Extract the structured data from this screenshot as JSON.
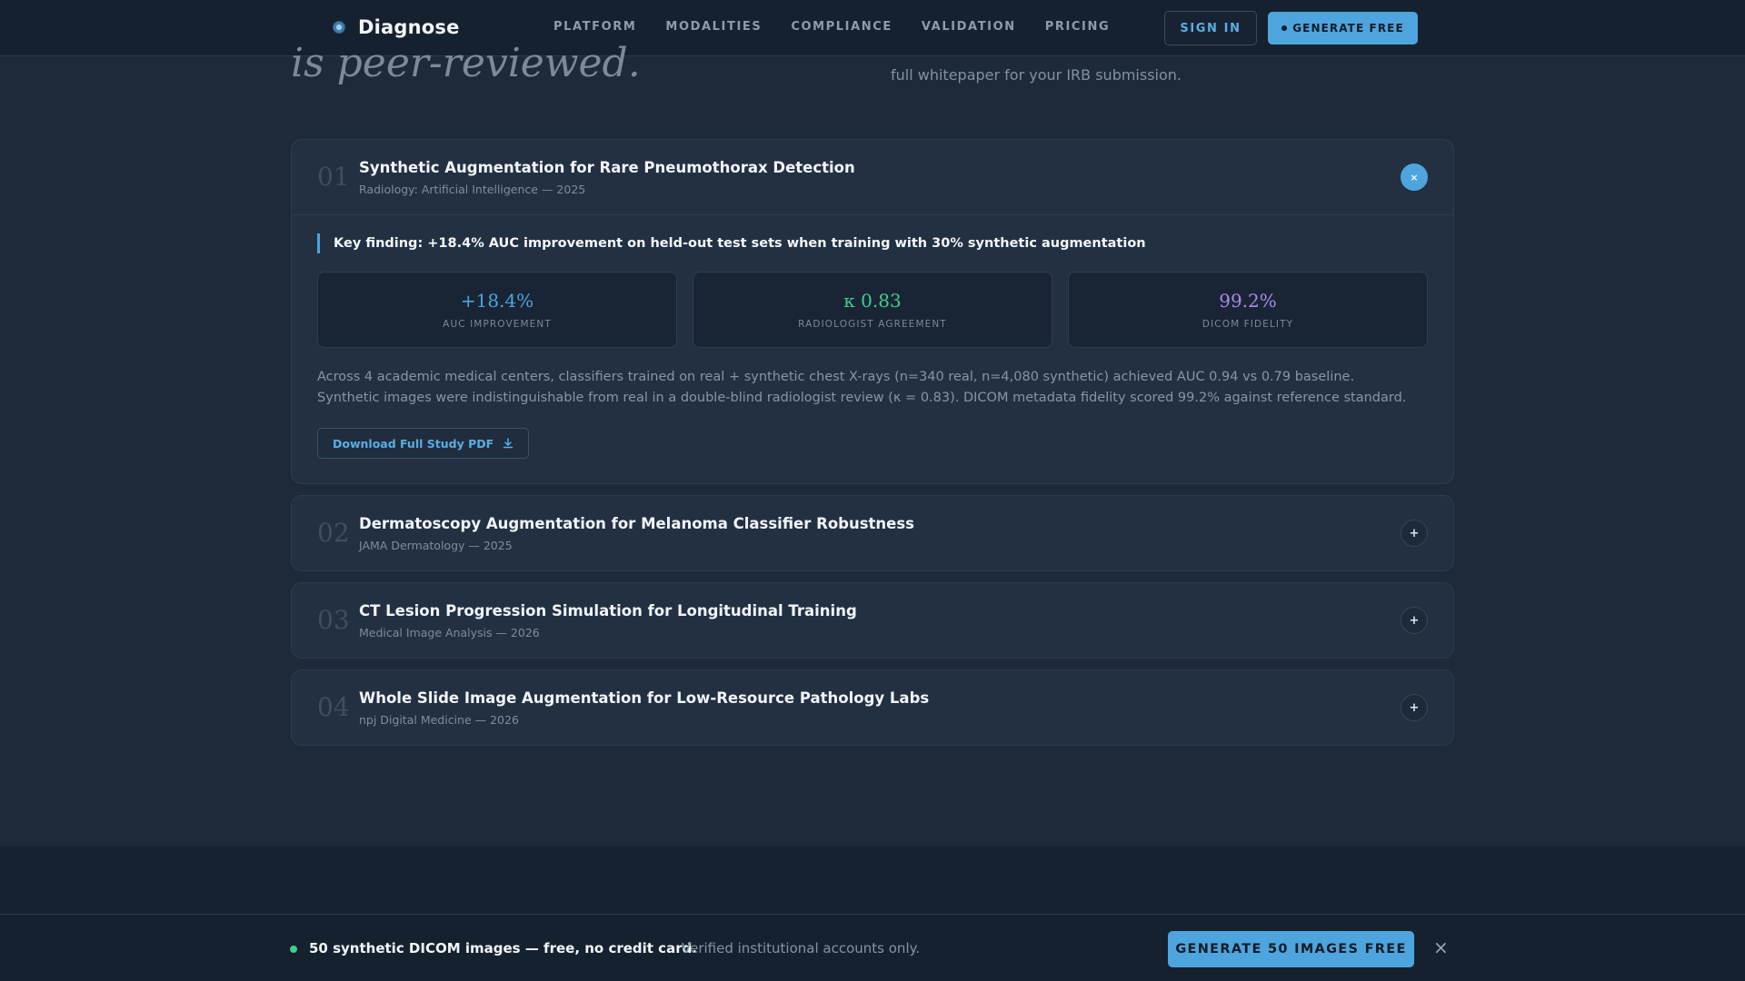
{
  "nav": {
    "brand": "Diagnose",
    "links": [
      "PLATFORM",
      "MODALITIES",
      "COMPLIANCE",
      "VALIDATION",
      "PRICING"
    ],
    "signin": "SIGN IN",
    "generate": "GENERATE FREE"
  },
  "hero": {
    "title_fragment": "is peer-reviewed.",
    "subtitle_fragment": "full whitepaper for your IRB submission."
  },
  "studies": [
    {
      "num": "01",
      "title": "Synthetic Augmentation for Rare Pneumothorax Detection",
      "meta": "Radiology: Artificial Intelligence — 2025",
      "toggle": "×",
      "finding": "Key finding: +18.4% AUC improvement on held-out test sets when training with 30% synthetic augmentation",
      "stats": [
        {
          "value": "+18.4%",
          "label": "AUC IMPROVEMENT",
          "color": "#4ea4dc"
        },
        {
          "value": "κ 0.83",
          "label": "RADIOLOGIST AGREEMENT",
          "color": "#3ecf8e"
        },
        {
          "value": "99.2%",
          "label": "DICOM FIDELITY",
          "color": "#a98be6"
        }
      ],
      "description": "Across 4 academic medical centers, classifiers trained on real + synthetic chest X-rays (n=340 real, n=4,080 synthetic) achieved AUC 0.94 vs 0.79 baseline. Synthetic images were indistinguishable from real in a double-blind radiologist review (κ = 0.83). DICOM metadata fidelity scored 99.2% against reference standard.",
      "download": "Download Full Study PDF"
    },
    {
      "num": "02",
      "title": "Dermatoscopy Augmentation for Melanoma Classifier Robustness",
      "meta": "JAMA Dermatology — 2025",
      "toggle": "+"
    },
    {
      "num": "03",
      "title": "CT Lesion Progression Simulation for Longitudinal Training",
      "meta": "Medical Image Analysis — 2026",
      "toggle": "+"
    },
    {
      "num": "04",
      "title": "Whole Slide Image Augmentation for Low-Resource Pathology Labs",
      "meta": "npj Digital Medicine — 2026",
      "toggle": "+"
    }
  ],
  "banner": {
    "main": "50 synthetic DICOM images — free, no credit card.",
    "sub": "Verified institutional accounts only.",
    "cta": "GENERATE 50 IMAGES FREE",
    "close": "×"
  },
  "icons": {
    "brand": "logo-icon",
    "download": "download-icon",
    "close": "close-icon",
    "expand": "plus-icon",
    "status_dot": "status-dot-icon"
  },
  "colors": {
    "accent": "#4ea4dc",
    "success": "#3ecf8e",
    "purple": "#a98be6",
    "background": "#1e2a3a"
  }
}
